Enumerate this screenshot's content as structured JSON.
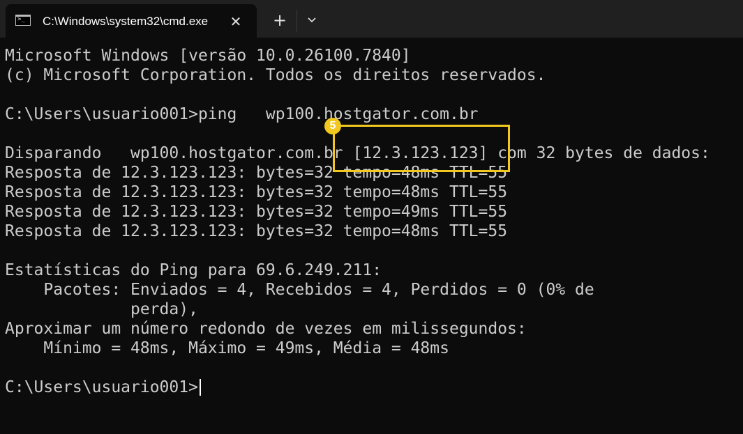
{
  "tab": {
    "title": "C:\\Windows\\system32\\cmd.exe",
    "icon": "cmd-icon",
    "close_glyph": "✕",
    "new_tab_glyph": "+",
    "dropdown_icon": "chevron-down-icon"
  },
  "console": {
    "lines": [
      "Microsoft Windows [versão 10.0.26100.7840]",
      "(c) Microsoft Corporation. Todos os direitos reservados.",
      "",
      "C:\\Users\\usuario001>ping   wp100.hostgator.com.br",
      "",
      "Disparando   wp100.hostgator.com.br [12.3.123.123] com 32 bytes de dados:",
      "Resposta de 12.3.123.123: bytes=32 tempo=48ms TTL=55",
      "Resposta de 12.3.123.123: bytes=32 tempo=48ms TTL=55",
      "Resposta de 12.3.123.123: bytes=32 tempo=49ms TTL=55",
      "Resposta de 12.3.123.123: bytes=32 tempo=48ms TTL=55",
      "",
      "Estatísticas do Ping para 69.6.249.211:",
      "    Pacotes: Enviados = 4, Recebidos = 4, Perdidos = 0 (0% de",
      "             perda),",
      "Aproximar um número redondo de vezes em milissegundos:",
      "    Mínimo = 48ms, Máximo = 49ms, Média = 48ms",
      "",
      "C:\\Users\\usuario001>"
    ]
  },
  "annotation": {
    "step": "5",
    "color": "#f2c81e"
  },
  "colors": {
    "background": "#0c0c0c",
    "tabbar": "#202020",
    "text": "#cccccc"
  }
}
